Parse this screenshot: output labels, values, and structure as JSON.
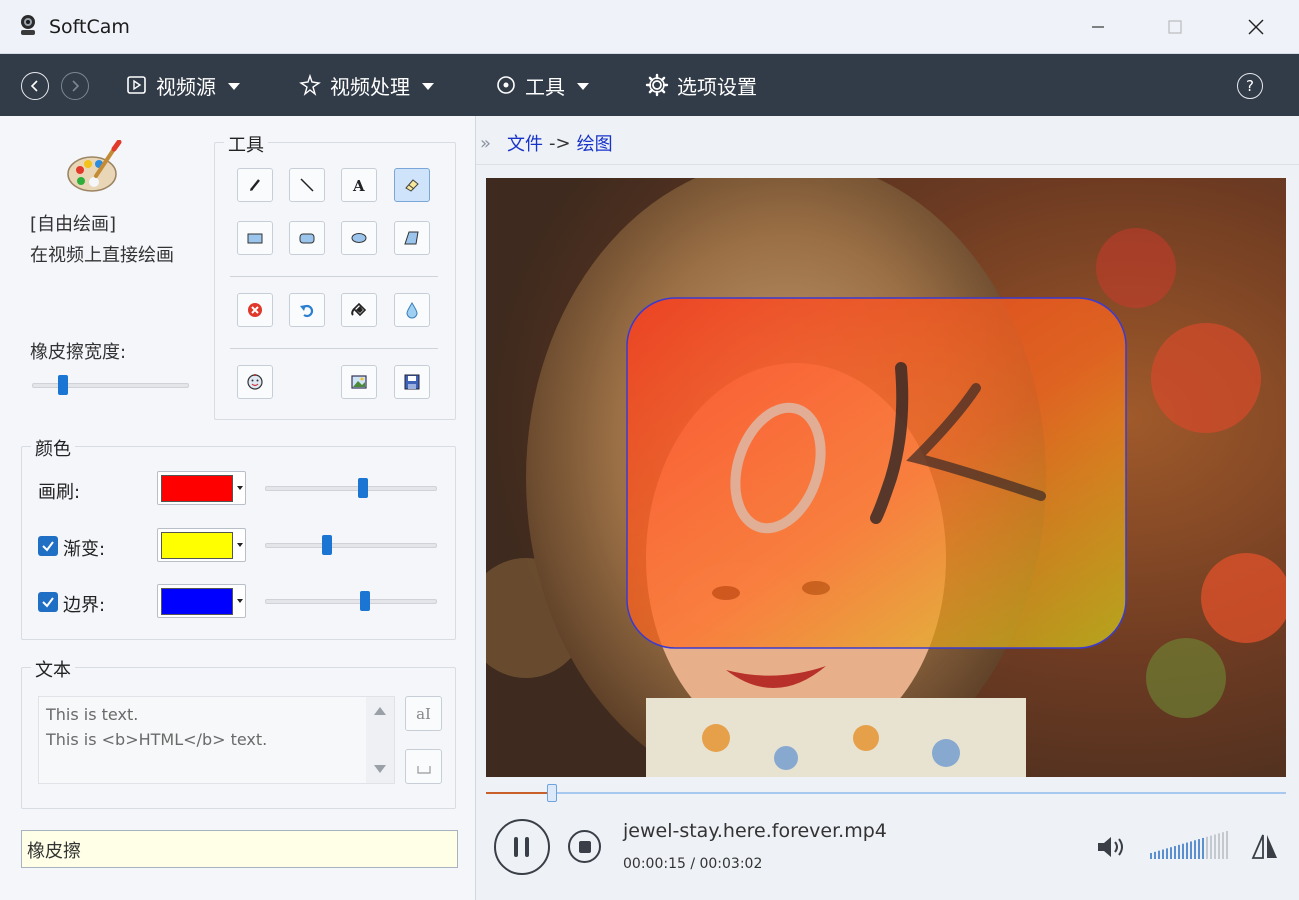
{
  "window": {
    "title": "SoftCam"
  },
  "toolbar": {
    "menus": [
      {
        "label": "视频源"
      },
      {
        "label": "视频处理"
      },
      {
        "label": "工具"
      },
      {
        "label": "选项设置"
      }
    ],
    "help": "?"
  },
  "left": {
    "mode_title": "[自由绘画]",
    "mode_desc": "在视频上直接绘画",
    "eraser_width_label": "橡皮擦宽度:",
    "eraser_width_value": 0.2,
    "tools_group": "工具",
    "color_group": "颜色",
    "brush_label": "画刷:",
    "gradient_label": "渐变:",
    "border_label": "边界:",
    "brush_color": "#ff0000",
    "gradient_color": "#ffff00",
    "border_color": "#0000ff",
    "brush_slider": 0.57,
    "gradient_slider": 0.36,
    "border_slider": 0.58,
    "gradient_checked": true,
    "border_checked": true,
    "text_group": "文本",
    "text_line1": "This is text.",
    "text_line2": "This is <b>HTML</b> text.",
    "font_btn": "aI",
    "status_text": "橡皮擦"
  },
  "breadcrumb": {
    "file": "文件",
    "arrow": "->",
    "current": "绘图"
  },
  "player": {
    "file_name": "jewel-stay.here.forever.mp4",
    "time": "00:00:15 / 00:03:02",
    "progress": 0.083,
    "volume_level": 0.7,
    "overlay_text": "OK"
  },
  "colors": {
    "toolbar_bg": "#323b48",
    "accent": "#1a76d2"
  }
}
